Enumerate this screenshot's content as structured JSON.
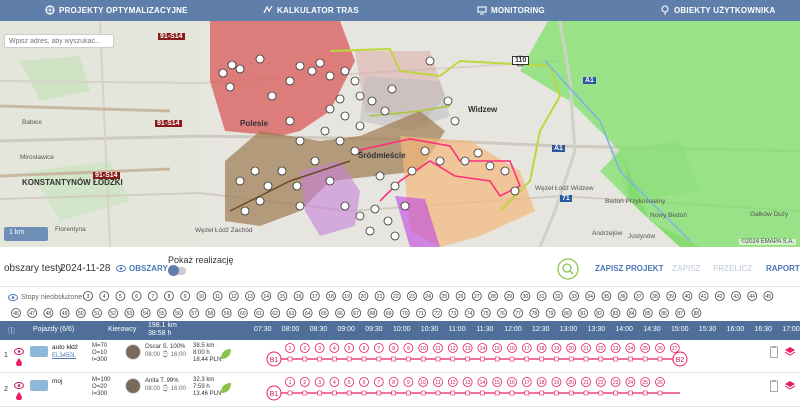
{
  "nav": {
    "items": [
      {
        "label": "PROJEKTY OPTYMALIZACYJNE",
        "icon": "globe-icon"
      },
      {
        "label": "KALKULATOR TRAS",
        "icon": "route-icon"
      },
      {
        "label": "MONITORING",
        "icon": "monitor-icon"
      },
      {
        "label": "OBIEKTY UŻYTKOWNIKA",
        "icon": "location-icon"
      }
    ]
  },
  "map": {
    "search_placeholder": "Wpisz adres, aby wyszukać...",
    "labels": {
      "polesie": "Polesie",
      "widzew": "Widzew",
      "srodmiescie": "Śródmieście",
      "konstantynow": "KONSTANTYNÓW ŁÓDZKI",
      "bedon": "Bedoń Przykościelny",
      "andrzejow": "Andrzejów",
      "justynow": "Justynów",
      "nowy_bedon": "Nowy Bedoń",
      "galkow": "Gałków Duży",
      "babice": "Babice",
      "mirosławice": "Mirosławice",
      "florentyna": "Florentyna",
      "lodz_widzew": "Węzeł Łódź Widzew",
      "lodz_zachod": "Węzeł Łódź Zachód"
    },
    "road_tags": {
      "s14a": "91-S14",
      "s14b": "91-S14",
      "s14c": "91-S14",
      "r110": "110",
      "a1": "A1",
      "a1b": "A1",
      "r71": "71"
    },
    "copyright": "©2024 EMAPA S.A.",
    "zoom_label": "1 km"
  },
  "toolbar": {
    "title": "obszary testy",
    "date": "2024-11-28",
    "areas_label": "OBSZARY",
    "show_label": "Pokaż realizację",
    "save_label": "ZAPISZ PROJEKT",
    "btn2_label": "ZAPISZ",
    "btn3_label": "PRZELICZ",
    "report_label": "RAPORT"
  },
  "stops": {
    "label": "Stopy nieobsłużone:",
    "row1": [
      "3",
      "4",
      "5",
      "6",
      "7",
      "8",
      "9",
      "10",
      "11",
      "12",
      "13",
      "14",
      "15",
      "16",
      "17",
      "18",
      "19",
      "20",
      "21",
      "22",
      "23",
      "24",
      "25",
      "26",
      "27",
      "28",
      "29",
      "30",
      "31",
      "32",
      "33",
      "34",
      "35",
      "36",
      "37",
      "38",
      "39",
      "40",
      "41",
      "42",
      "43",
      "44",
      "45"
    ],
    "row2": [
      "46",
      "47",
      "48",
      "49",
      "50",
      "51",
      "52",
      "53",
      "54",
      "55",
      "56",
      "57",
      "58",
      "59",
      "60",
      "61",
      "62",
      "63",
      "64",
      "65",
      "66",
      "67",
      "68",
      "69",
      "70",
      "71",
      "72",
      "73",
      "74",
      "75",
      "76",
      "77",
      "78",
      "79",
      "80",
      "81",
      "82",
      "83",
      "84",
      "85",
      "86",
      "87",
      "88"
    ]
  },
  "grid": {
    "vehicles_header": "Pojazdy (6/6)",
    "driver_header": "Kierowcy",
    "total_km": "198.1 km",
    "total_time": "38:58 h",
    "hours": [
      "07:30",
      "08:00",
      "08:30",
      "09:00",
      "09:30",
      "10:00",
      "10:30",
      "11:00",
      "11:30",
      "12:00",
      "12:30",
      "13:00",
      "13:30",
      "14:00",
      "14:30",
      "15:00",
      "15:30",
      "16:00",
      "16:30",
      "17:00"
    ],
    "rows": [
      {
        "num": "1",
        "vehicle_name": "auto kłdź",
        "vehicle_id": "EL3450L",
        "cap": [
          "M=70",
          "O=10",
          "I=300"
        ],
        "driver": "Oscar S. 100%",
        "time": "08:00 ⌚ 16:00",
        "km": "38.5 km",
        "hours": "8:00 h",
        "cost": "18.44 PLN",
        "start": "B1",
        "end": "B2",
        "stops": [
          "1",
          "2",
          "3",
          "4",
          "5",
          "6",
          "7",
          "8",
          "9",
          "10",
          "11",
          "12",
          "13",
          "14",
          "15",
          "16",
          "17",
          "18",
          "19",
          "20",
          "21",
          "22",
          "23",
          "24",
          "25",
          "26",
          "27"
        ]
      },
      {
        "num": "2",
        "vehicle_name": "moj",
        "vehicle_id": "",
        "cap": [
          "M=100",
          "O=20",
          "I=300"
        ],
        "driver": "Anita T. 99%",
        "time": "08:00 ⌚ 16:00",
        "km": "32.3 km",
        "hours": "7:59 h",
        "cost": "13.46 PLN",
        "start": "B1",
        "end": "",
        "stops": [
          "1",
          "2",
          "3",
          "4",
          "5",
          "6",
          "7",
          "8",
          "9",
          "10",
          "11",
          "12",
          "13",
          "14",
          "15",
          "16",
          "17",
          "18",
          "19",
          "20",
          "21",
          "22",
          "23",
          "24",
          "25",
          "26"
        ]
      }
    ]
  }
}
